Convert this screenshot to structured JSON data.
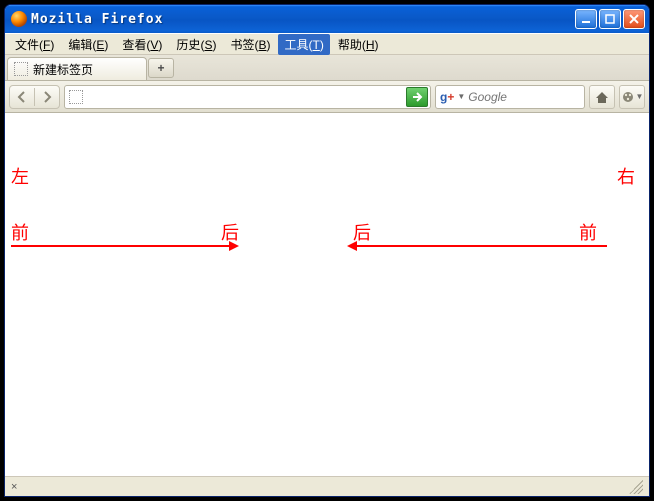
{
  "window": {
    "title": "Mozilla Firefox"
  },
  "menu": {
    "file": {
      "label": "文件",
      "accel": "F"
    },
    "edit": {
      "label": "编辑",
      "accel": "E"
    },
    "view": {
      "label": "查看",
      "accel": "V"
    },
    "history": {
      "label": "历史",
      "accel": "S"
    },
    "bookmarks": {
      "label": "书签",
      "accel": "B"
    },
    "tools": {
      "label": "工具",
      "accel": "T"
    },
    "help": {
      "label": "帮助",
      "accel": "H"
    }
  },
  "tabs": {
    "tab0": {
      "label": "新建标签页"
    },
    "newtab_plus": "+"
  },
  "toolbar": {
    "url_value": "",
    "go_arrow": "→",
    "search_placeholder": "Google"
  },
  "statusbar": {
    "close_x": "×"
  },
  "content": {
    "left_label": "左",
    "right_label": "右",
    "front1": "前",
    "back1": "后",
    "back2": "后",
    "front2": "前"
  }
}
